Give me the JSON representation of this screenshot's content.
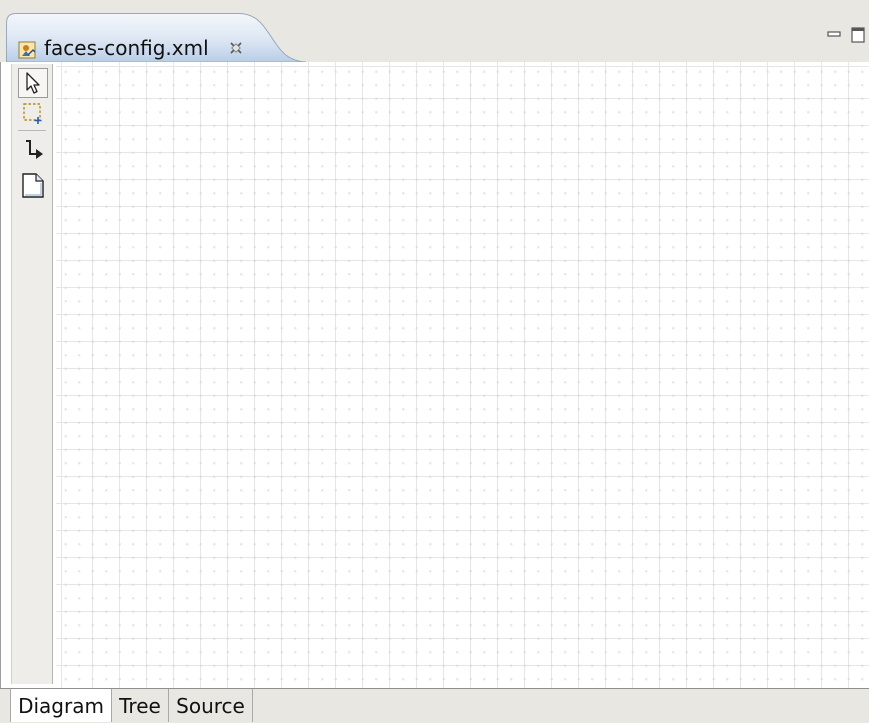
{
  "editor_tab": {
    "title": "faces-config.xml",
    "icon": "faces-config-file-icon",
    "close_icon": "close-icon"
  },
  "window_controls": {
    "minimize_icon": "minimize-icon",
    "maximize_icon": "maximize-icon"
  },
  "palette": {
    "tools": [
      {
        "name": "select-tool",
        "icon": "arrow-pointer-icon",
        "selected": true
      },
      {
        "name": "marquee-tool",
        "icon": "marquee-icon",
        "selected": false
      },
      {
        "name": "connection-tool",
        "icon": "connection-icon",
        "selected": false
      },
      {
        "name": "page-tool",
        "icon": "page-icon",
        "selected": false
      }
    ]
  },
  "bottom_tabs": [
    {
      "label": "Diagram",
      "active": true
    },
    {
      "label": "Tree",
      "active": false
    },
    {
      "label": "Source",
      "active": false
    }
  ],
  "colors": {
    "tab_highlight": "#c5d7ef",
    "tab_bar_background": "#e9e7e2",
    "grid_line": "#e6e6e6"
  }
}
